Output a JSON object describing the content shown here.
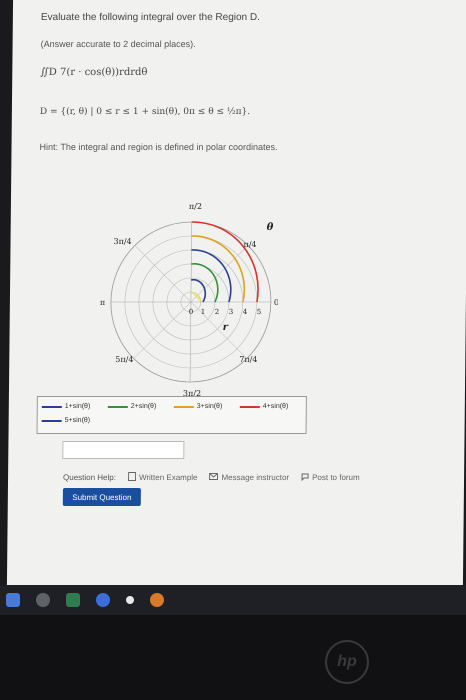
{
  "question": {
    "title": "Evaluate the following integral over the Region D.",
    "subtitle": "(Answer accurate to 2 decimal places).",
    "integral": "∬D 7(r · cos(θ))rdrdθ",
    "region": "D = {(r, θ) | 0 ≤ r ≤ 1 + sin(θ), 0π ≤ θ ≤ ½π}.",
    "hint": "Hint: The integral and region is defined in polar coordinates."
  },
  "plot": {
    "angle_labels": {
      "pi_over_2": "π/2",
      "three_pi_over_4": "3π/4",
      "pi_over_4": "π/4",
      "pi": "π",
      "zero": "0",
      "five_pi_over_4": "5π/4",
      "three_pi_over_2": "3π/2",
      "seven_pi_over_4": "7π/4",
      "theta": "θ"
    },
    "radial_ticks": [
      "0",
      "1",
      "2",
      "3",
      "4",
      "5"
    ],
    "r_label": "r"
  },
  "legend": [
    {
      "label": "1+sin(θ)",
      "color": "#2c3f94"
    },
    {
      "label": "2+sin(θ)",
      "color": "#3a8f3a"
    },
    {
      "label": "3+sin(θ)",
      "color": "#e0a21c"
    },
    {
      "label": "4+sin(θ)",
      "color": "#d8322a"
    },
    {
      "label": "5+sin(θ)",
      "color": "#2c3f94"
    }
  ],
  "help": {
    "label": "Question Help:",
    "written_example": "Written Example",
    "message_instructor": "Message instructor",
    "post_to_forum": "Post to forum"
  },
  "submit_label": "Submit Question",
  "brand": "hp"
}
